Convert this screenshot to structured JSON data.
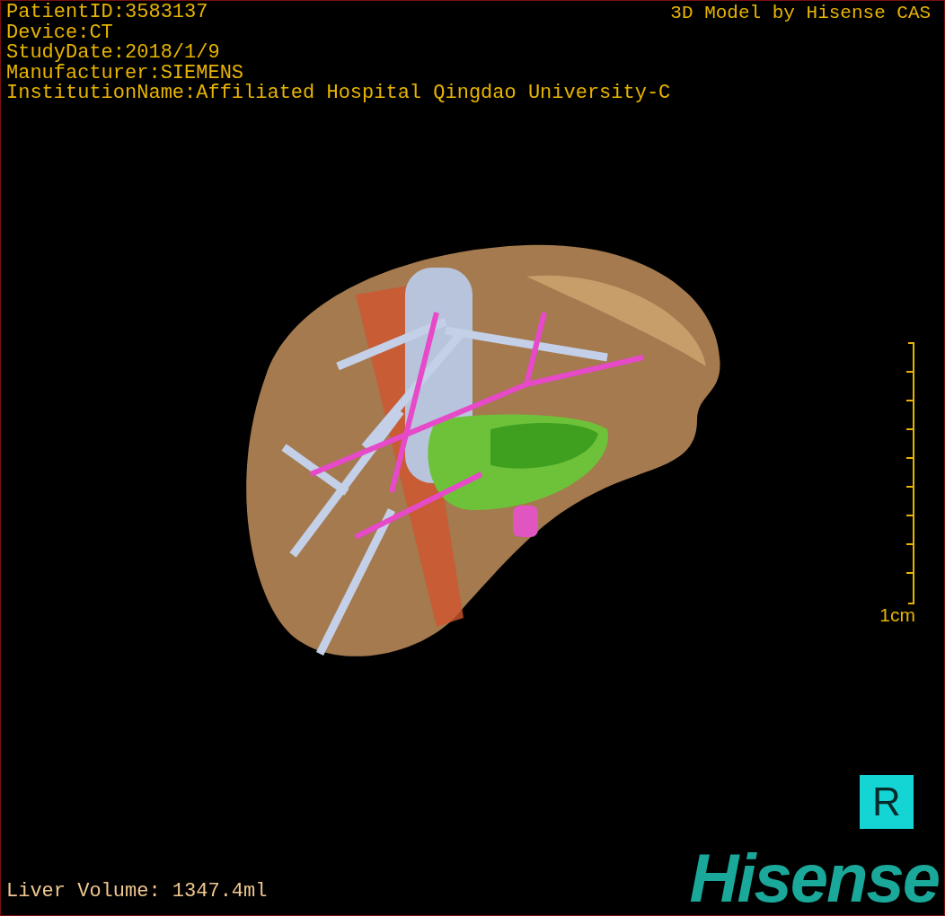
{
  "info_lines": [
    "PatientID:3583137",
    "Device:CT",
    "StudyDate:2018/1/9",
    "Manufacturer:SIEMENS",
    "InstitutionName:Affiliated Hospital Qingdao University-C"
  ],
  "model_credit": "3D Model by Hisense CAS",
  "scale_bar": {
    "label": "1cm"
  },
  "orientation_marker": "R",
  "logo": "Hisense",
  "liver_volume": "Liver Volume: 1347.4ml"
}
